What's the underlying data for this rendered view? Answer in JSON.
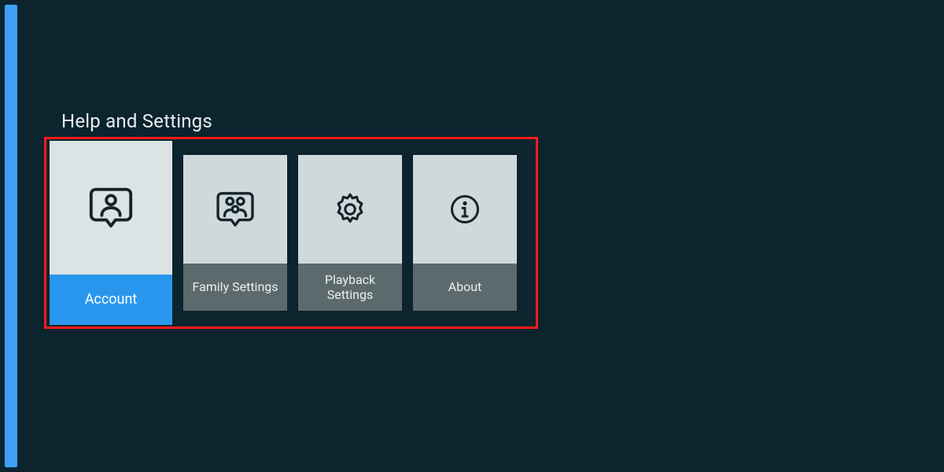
{
  "page": {
    "title": "Help and Settings"
  },
  "tiles": [
    {
      "label": "Account",
      "icon": "person-bubble-icon",
      "selected": true
    },
    {
      "label": "Family Settings",
      "icon": "family-bubble-icon",
      "selected": false
    },
    {
      "label": "Playback Settings",
      "icon": "gear-icon",
      "selected": false
    },
    {
      "label": "About",
      "icon": "info-icon",
      "selected": false
    }
  ],
  "colors": {
    "background": "#0b242e",
    "accent": "#3ea0f6",
    "tile": "#cfd9db",
    "tileSelected": "#dbe3e4",
    "labelBg": "#5d6a6d",
    "labelSelectedBg": "#2a97ee",
    "highlight": "#ff1b1b"
  }
}
